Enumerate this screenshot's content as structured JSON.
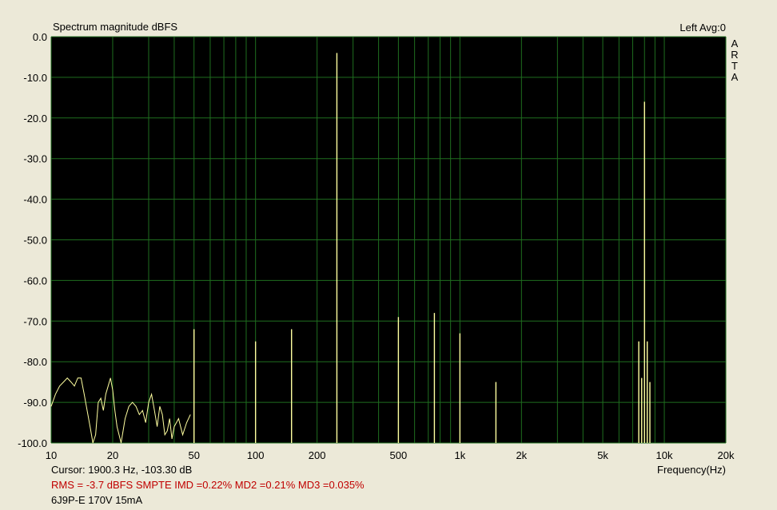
{
  "chart_data": {
    "type": "line",
    "title": "Spectrum magnitude dBFS",
    "channel_label": "Left  Avg:0",
    "watermark": [
      "A",
      "R",
      "T",
      "A"
    ],
    "xlabel": "Frequency(Hz)",
    "ylabel": "",
    "xscale": "log",
    "xlim": [
      10,
      20000
    ],
    "ylim": [
      -100,
      0
    ],
    "grid": true,
    "background": "#000000",
    "grid_color": "#1f6e1f",
    "series_color": "#ffffa0",
    "x_ticks": [
      10,
      20,
      50,
      100,
      200,
      500,
      1000,
      2000,
      5000,
      10000,
      20000
    ],
    "x_tick_labels": [
      "10",
      "20",
      "50",
      "100",
      "200",
      "500",
      "1k",
      "2k",
      "5k",
      "10k",
      "20k"
    ],
    "y_ticks": [
      0,
      -10,
      -20,
      -30,
      -40,
      -50,
      -60,
      -70,
      -80,
      -90,
      -100
    ],
    "y_tick_labels": [
      "0.0",
      "-10.0",
      "-20.0",
      "-30.0",
      "-40.0",
      "-50.0",
      "-60.0",
      "-70.0",
      "-80.0",
      "-90.0",
      "-100.0"
    ],
    "low_freq_noise": {
      "x": [
        10,
        10.5,
        11,
        11.5,
        12,
        12.5,
        13,
        13.5,
        14,
        14.5,
        15,
        15.5,
        16,
        16.5,
        17,
        17.5,
        18,
        18.5,
        19,
        19.5,
        20,
        20.5,
        21,
        22,
        23,
        24,
        25,
        26,
        27,
        28,
        29,
        30,
        31,
        32,
        33,
        34,
        35,
        36,
        37,
        38,
        39,
        40,
        42,
        44,
        46,
        48
      ],
      "y": [
        -91,
        -88,
        -86,
        -85,
        -84,
        -85,
        -86,
        -84,
        -84,
        -88,
        -92,
        -96,
        -100,
        -98,
        -90,
        -89,
        -92,
        -88,
        -86,
        -84,
        -87,
        -92,
        -96,
        -100,
        -94,
        -91,
        -90,
        -91,
        -93,
        -92,
        -95,
        -90,
        -88,
        -92,
        -96,
        -91,
        -93,
        -98,
        -97,
        -94,
        -99,
        -96,
        -94,
        -98,
        -95,
        -93
      ]
    },
    "peaks": [
      {
        "f": 50,
        "db": -72
      },
      {
        "f": 100,
        "db": -75
      },
      {
        "f": 150,
        "db": -72
      },
      {
        "f": 250,
        "db": -4
      },
      {
        "f": 500,
        "db": -69
      },
      {
        "f": 750,
        "db": -68
      },
      {
        "f": 1000,
        "db": -73
      },
      {
        "f": 1500,
        "db": -85
      },
      {
        "f": 1900,
        "db": -100
      },
      {
        "f": 7500,
        "db": -75
      },
      {
        "f": 7750,
        "db": -84
      },
      {
        "f": 8000,
        "db": -16
      },
      {
        "f": 8250,
        "db": -75
      },
      {
        "f": 8500,
        "db": -85
      }
    ]
  },
  "cursor_text": "Cursor:  1900.3 Hz, -103.30 dB",
  "measure_text": "RMS =   -3.7 dBFS   SMPTE IMD =0.22%  MD2 =0.21%  MD3 =0.035%",
  "note_text": "6J9P-E 170V 15mA"
}
